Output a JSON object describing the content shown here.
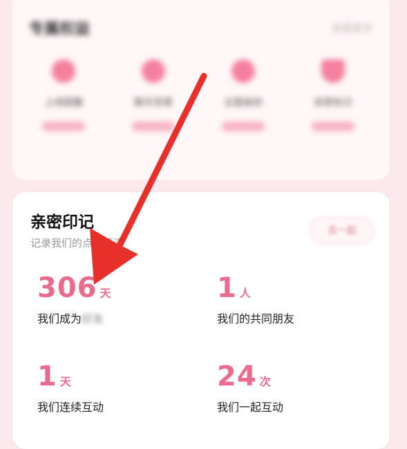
{
  "top_card": {
    "title": "专属权益",
    "more": "查看更多",
    "features": [
      {
        "label": "上线提醒"
      },
      {
        "label": "聊天背景"
      },
      {
        "label": "主题装扮"
      },
      {
        "label": "亲密标识"
      }
    ]
  },
  "intimacy": {
    "title": "亲密印记",
    "subtitle": "记录我们的点点滴滴",
    "button_label": "去一起",
    "stats": [
      {
        "value": "306",
        "unit": "天",
        "label": "我们成为",
        "blurred": "好友"
      },
      {
        "value": "1",
        "unit": "人",
        "label": "我们的共同朋友"
      },
      {
        "value": "1",
        "unit": "天",
        "label": "我们连续互动"
      },
      {
        "value": "24",
        "unit": "次",
        "label": "我们一起互动"
      }
    ]
  },
  "colors": {
    "accent": "#ea6b8b",
    "arrow": "#e8302b",
    "background": "#fbe9ec"
  }
}
